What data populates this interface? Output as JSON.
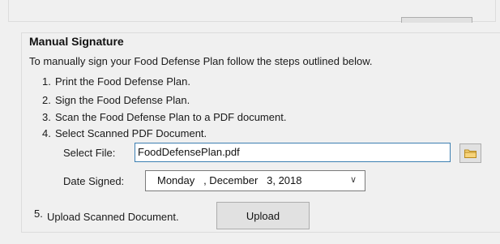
{
  "manual_signature": {
    "title": "Manual Signature",
    "intro": "To manually sign your Food Defense Plan follow the steps outlined below.",
    "steps": [
      {
        "num": "1.",
        "text": "Print the Food Defense Plan."
      },
      {
        "num": "2.",
        "text": "Sign the Food Defense Plan."
      },
      {
        "num": "3.",
        "text": "Scan the Food Defense Plan to a PDF document."
      },
      {
        "num": "4.",
        "text": "Select Scanned PDF Document."
      },
      {
        "num": "5.",
        "text": "Upload Scanned Document."
      }
    ],
    "select_file": {
      "label": "Select File:",
      "value": "FoodDefensePlan.pdf",
      "browse_icon": "folder-icon"
    },
    "date_signed": {
      "label": "Date Signed:",
      "value": "Monday   , December   3, 2018",
      "dropdown_icon": "chevron-down-icon"
    },
    "upload_label": "Upload"
  },
  "colors": {
    "background": "#f0f0f0",
    "input_focus_border": "#3c7fb1",
    "button_face": "#e1e1e1",
    "folder_icon": "#e8b84a"
  }
}
